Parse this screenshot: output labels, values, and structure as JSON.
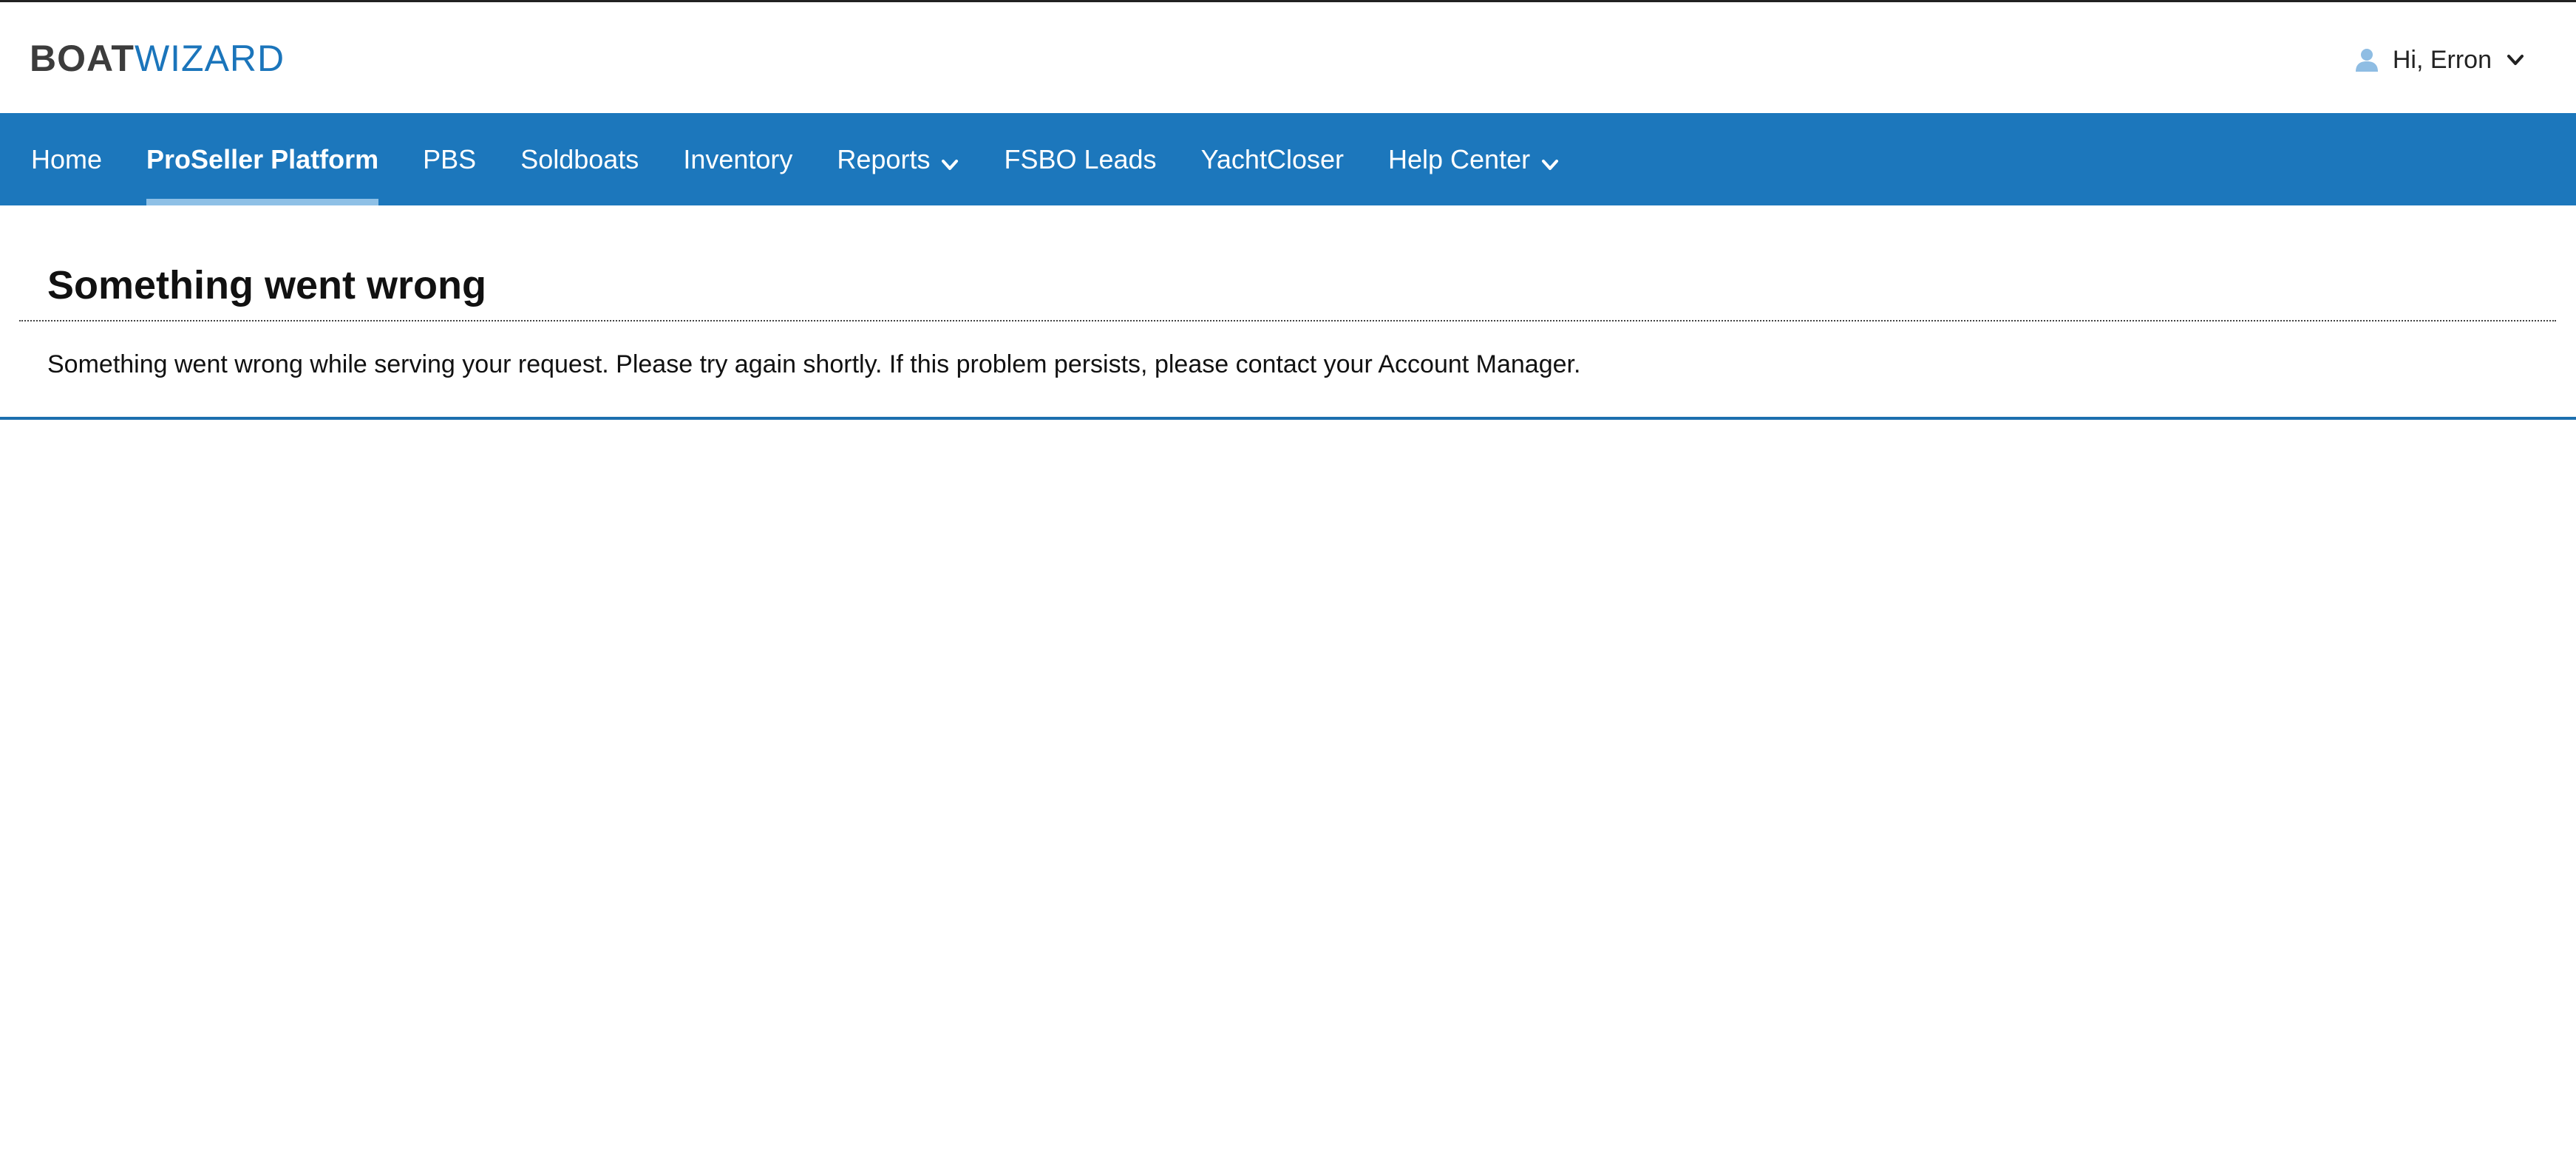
{
  "header": {
    "logo": {
      "part1": "BOAT",
      "part2": "WIZARD"
    },
    "user": {
      "icon": "user-icon",
      "greeting": "Hi, Erron",
      "dropdown_icon": "chevron-down-icon"
    }
  },
  "nav": {
    "items": [
      {
        "label": "Home",
        "active": false,
        "has_dropdown": false
      },
      {
        "label": "ProSeller Platform",
        "active": true,
        "has_dropdown": false
      },
      {
        "label": "PBS",
        "active": false,
        "has_dropdown": false
      },
      {
        "label": "Soldboats",
        "active": false,
        "has_dropdown": false
      },
      {
        "label": "Inventory",
        "active": false,
        "has_dropdown": false
      },
      {
        "label": "Reports",
        "active": false,
        "has_dropdown": true
      },
      {
        "label": "FSBO Leads",
        "active": false,
        "has_dropdown": false
      },
      {
        "label": "YachtCloser",
        "active": false,
        "has_dropdown": false
      },
      {
        "label": "Help Center",
        "active": false,
        "has_dropdown": true
      }
    ]
  },
  "main": {
    "title": "Something went wrong",
    "message": "Something went wrong while serving your request. Please try again shortly. If this problem persists, please contact your Account Manager."
  },
  "colors": {
    "brand_blue": "#1c77bc",
    "active_underline": "#8ec0e6",
    "logo_dark": "#3c3c3c",
    "logo_blue": "#1b75bb",
    "user_icon": "#8fbde3"
  }
}
